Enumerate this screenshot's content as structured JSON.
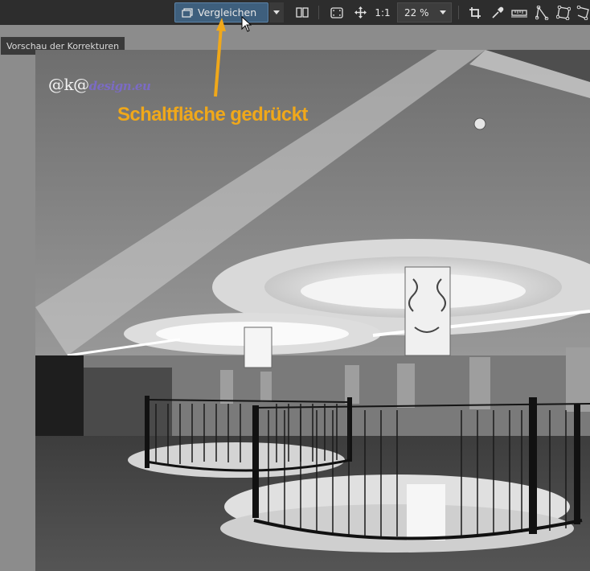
{
  "toolbar": {
    "compare_label": "Vergleichen",
    "one_to_one_label": "1:1",
    "zoom_value": "22 %"
  },
  "tooltip": {
    "text": "Vorschau der Korrekturen"
  },
  "watermark": {
    "prefix": "@k@",
    "suffix": "design.eu"
  },
  "annotation": {
    "text": "Schaltfläche gedrückt",
    "color": "#f0a81a"
  },
  "icons": [
    "compare-icon",
    "dropdown-icon",
    "split-view-icon",
    "fit-screen-icon",
    "pan-icon",
    "crop-icon",
    "eyedropper-icon",
    "straighten-icon",
    "perspective-icon",
    "perspective-polygon-icon",
    "freeform-icon",
    "mouse-cursor-icon",
    "annotation-arrow-icon"
  ],
  "colors": {
    "toolbar_bg": "#2d2d2d",
    "compare_active_bg": "#3e5f7d",
    "workspace_bg": "#8c8c8c"
  }
}
